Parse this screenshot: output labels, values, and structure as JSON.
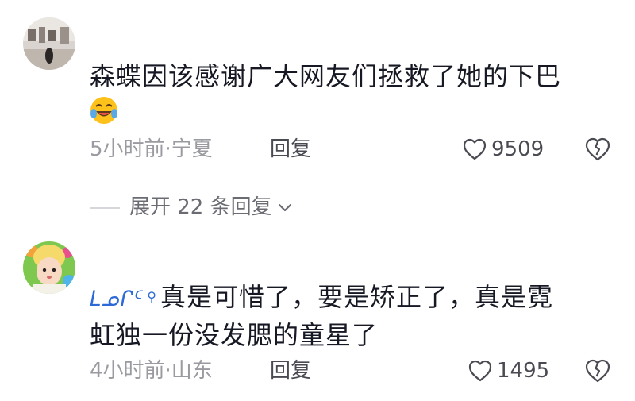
{
  "comments": [
    {
      "text": "森蝶因该感谢广大网友们拯救了她的下巴",
      "emoji_icon": "laughing-crying-emoji-icon",
      "time_location": "5小时前·宁夏",
      "reply_label": "回复",
      "likes": "9509",
      "expand_label": "展开 22 条回复"
    },
    {
      "username": "ᒪᓄᒋᑦ",
      "text_line1": "真是可惜了，要是矫正了，真是霓",
      "text_line2": "虹独一份没发腮的童星了",
      "time_location": "4小时前·山东",
      "reply_label": "回复",
      "likes": "1495"
    }
  ],
  "colors": {
    "text": "#161823",
    "meta": "#9a9ba1",
    "action": "#4a4b52"
  }
}
